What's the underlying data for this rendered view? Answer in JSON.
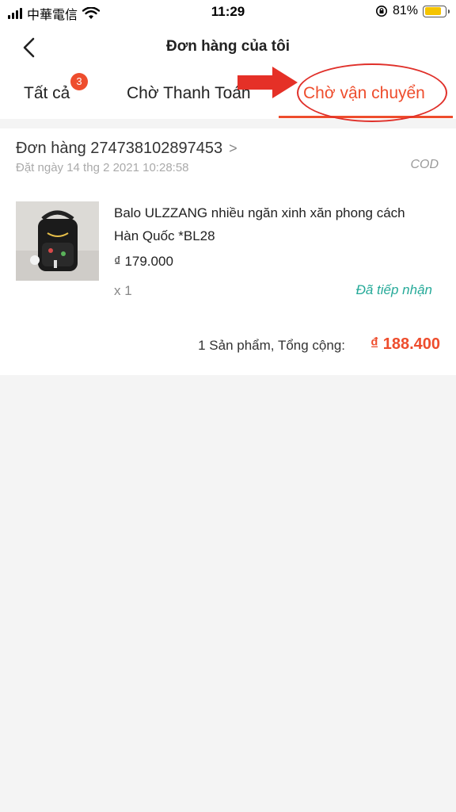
{
  "status_bar": {
    "carrier": "中華電信",
    "time": "11:29",
    "battery": "81%",
    "battery_level": 0.81
  },
  "header": {
    "title": "Đơn hàng của tôi"
  },
  "tabs": [
    {
      "label": "Tất cả",
      "badge": "3"
    },
    {
      "label": "Chờ Thanh Toán"
    },
    {
      "label": "Chờ vận chuyển",
      "active": true
    }
  ],
  "order": {
    "id_text": "Đơn hàng 274738102897453",
    "arrow": ">",
    "date_text": "Đặt ngày 14 thg 2 2021  10:28:58",
    "payment_method": "COD",
    "product": {
      "name": "Balo ULZZANG nhiều ngăn xinh xăn phong cách Hàn Quốc *BL28",
      "price": "₫ 179.000",
      "quantity": "x 1",
      "status": "Đã tiếp nhận"
    },
    "summary_label": "1 Sản phẩm, Tổng cộng:",
    "total": "₫ 188.400"
  },
  "colors": {
    "accent": "#ee4d2d",
    "status_teal": "#26aa99",
    "annotation_red": "#e0302a"
  }
}
